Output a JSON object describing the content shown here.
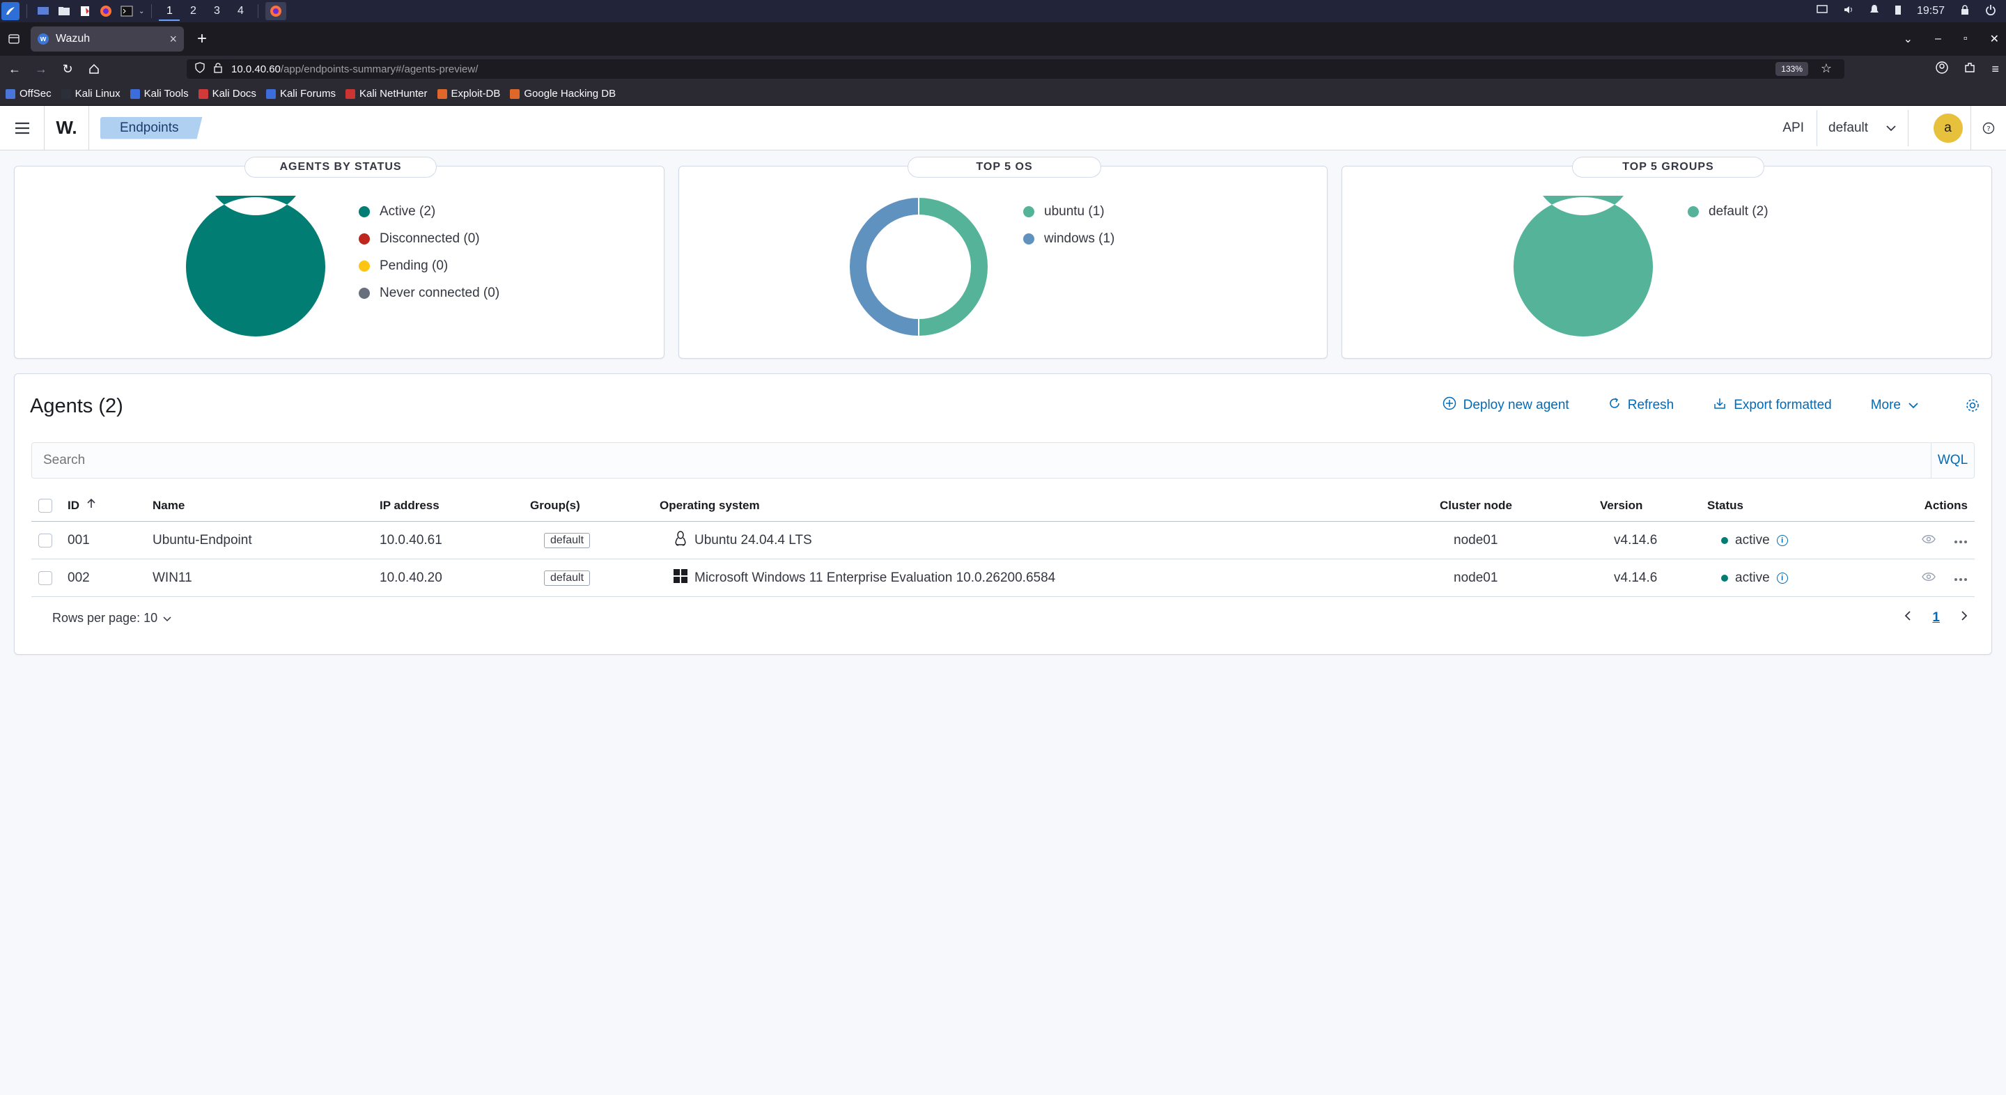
{
  "taskbar": {
    "workspaces": [
      "1",
      "2",
      "3",
      "4"
    ],
    "clock": "19:57"
  },
  "browser": {
    "tab_title": "Wazuh",
    "url_host": "10.0.40.60",
    "url_path": "/app/endpoints-summary#/agents-preview/",
    "zoom": "133%",
    "bookmarks": [
      "OffSec",
      "Kali Linux",
      "Kali Tools",
      "Kali Docs",
      "Kali Forums",
      "Kali NetHunter",
      "Exploit-DB",
      "Google Hacking DB"
    ]
  },
  "header": {
    "logo": "W.",
    "breadcrumb": "Endpoints",
    "api_label": "API",
    "api_value": "default",
    "avatar_letter": "a"
  },
  "panels": {
    "status": {
      "title": "AGENTS BY STATUS",
      "legend": [
        {
          "label": "Active (2)",
          "color": "#017d73"
        },
        {
          "label": "Disconnected (0)",
          "color": "#bd271e"
        },
        {
          "label": "Pending (0)",
          "color": "#fec514"
        },
        {
          "label": "Never connected (0)",
          "color": "#69707d"
        }
      ]
    },
    "os": {
      "title": "TOP 5 OS",
      "legend": [
        {
          "label": "ubuntu (1)",
          "color": "#54b399"
        },
        {
          "label": "windows (1)",
          "color": "#6092c0"
        }
      ]
    },
    "groups": {
      "title": "TOP 5 GROUPS",
      "legend": [
        {
          "label": "default (2)",
          "color": "#54b399"
        }
      ]
    }
  },
  "chart_data": [
    {
      "type": "pie",
      "title": "AGENTS BY STATUS",
      "categories": [
        "Active",
        "Disconnected",
        "Pending",
        "Never connected"
      ],
      "values": [
        2,
        0,
        0,
        0
      ]
    },
    {
      "type": "pie",
      "title": "TOP 5 OS",
      "categories": [
        "ubuntu",
        "windows"
      ],
      "values": [
        1,
        1
      ]
    },
    {
      "type": "pie",
      "title": "TOP 5 GROUPS",
      "categories": [
        "default"
      ],
      "values": [
        2
      ]
    }
  ],
  "agents": {
    "title": "Agents (2)",
    "actions": {
      "deploy": "Deploy new agent",
      "refresh": "Refresh",
      "export": "Export formatted",
      "more": "More"
    },
    "search_placeholder": "Search",
    "wql": "WQL",
    "columns": {
      "id": "ID",
      "name": "Name",
      "ip": "IP address",
      "groups": "Group(s)",
      "os": "Operating system",
      "cluster": "Cluster node",
      "version": "Version",
      "status": "Status",
      "actions": "Actions"
    },
    "rows": [
      {
        "id": "001",
        "name": "Ubuntu-Endpoint",
        "ip": "10.0.40.61",
        "group": "default",
        "os_icon": "linux-tux-icon",
        "os": "Ubuntu 24.04.4 LTS",
        "cluster": "node01",
        "version": "v4.14.6",
        "status": "active"
      },
      {
        "id": "002",
        "name": "WIN11",
        "ip": "10.0.40.20",
        "group": "default",
        "os_icon": "windows-logo-icon",
        "os": "Microsoft Windows 11 Enterprise Evaluation 10.0.26200.6584",
        "cluster": "node01",
        "version": "v4.14.6",
        "status": "active"
      }
    ],
    "rows_per_page": "Rows per page: 10",
    "current_page": "1"
  }
}
